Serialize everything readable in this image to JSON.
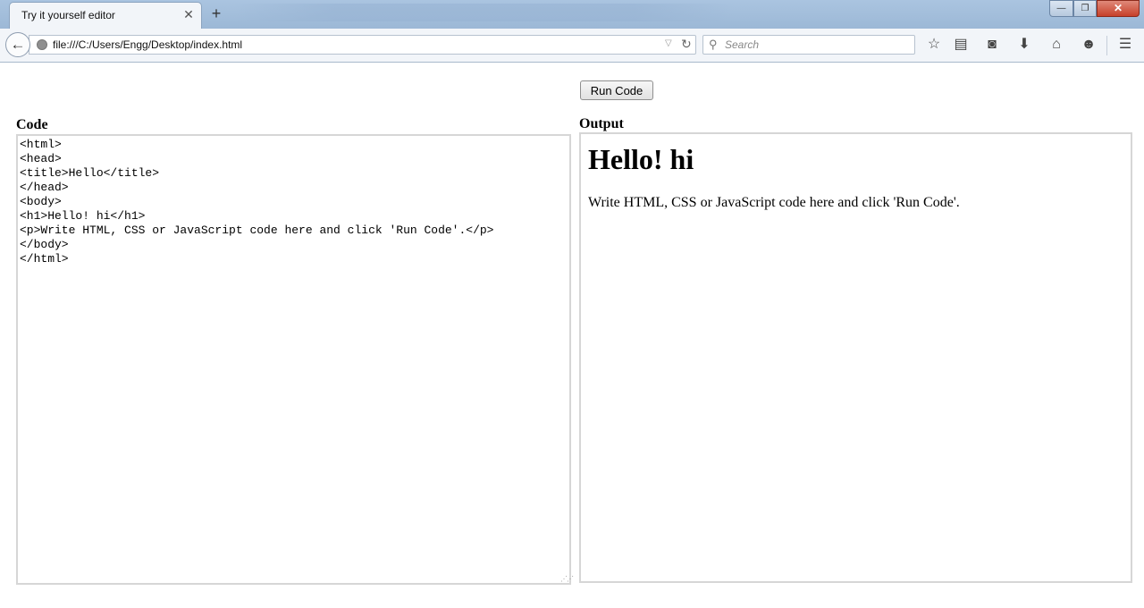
{
  "browser": {
    "tab_title": "Try it yourself editor",
    "tab_close": "✕",
    "new_tab": "+",
    "url": "file:///C:/Users/Engg/Desktop/index.html",
    "search_placeholder": "Search",
    "window_buttons": {
      "minimize": "—",
      "maximize": "❐",
      "close": "✕"
    },
    "toolbar_icons": [
      "star-icon",
      "reading-list-icon",
      "pocket-icon",
      "download-icon",
      "home-icon",
      "chat-icon",
      "menu-icon"
    ]
  },
  "page": {
    "run_button_label": "Run Code",
    "code_label": "Code",
    "output_label": "Output",
    "code": "<html>\n<head>\n<title>Hello</title>\n</head>\n<body>\n<h1>Hello! hi</h1>\n<p>Write HTML, CSS or JavaScript code here and click 'Run Code'.</p>\n</body>\n</html>",
    "output": {
      "heading": "Hello! hi",
      "paragraph": "Write HTML, CSS or JavaScript code here and click 'Run Code'."
    }
  }
}
